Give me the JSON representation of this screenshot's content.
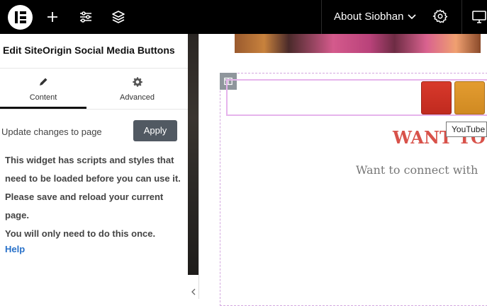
{
  "topbar": {
    "site_title": "About Siobhan",
    "icons": [
      "elementor-logo",
      "plus-icon",
      "sliders-icon",
      "layers-icon",
      "chevron-down-icon",
      "gear-icon",
      "responsive-icon"
    ]
  },
  "panel": {
    "title": "Edit SiteOrigin Social Media Buttons",
    "tabs": [
      {
        "label": "Content",
        "icon": "pencil-icon",
        "active": true
      },
      {
        "label": "Advanced",
        "icon": "gear-icon",
        "active": false
      }
    ],
    "update_text": "Update changes to page",
    "apply_label": "Apply",
    "notice_lines": [
      "This widget has scripts and styles that",
      "need to be loaded before you can use it.",
      "Please save and reload your current",
      "page.",
      "You will only need to do this once."
    ],
    "help_label": "Help"
  },
  "canvas": {
    "heading": "WANT TO ",
    "subtext": "Want to connect with",
    "tooltip": "YouTube",
    "social_colors": [
      "#d8392b",
      "#e39c30"
    ]
  },
  "colors": {
    "topbar": "#000000",
    "apply_button": "#515962",
    "help_link": "#2871c9",
    "heading": "#d8524a",
    "section_outline": "#d3a7df"
  }
}
